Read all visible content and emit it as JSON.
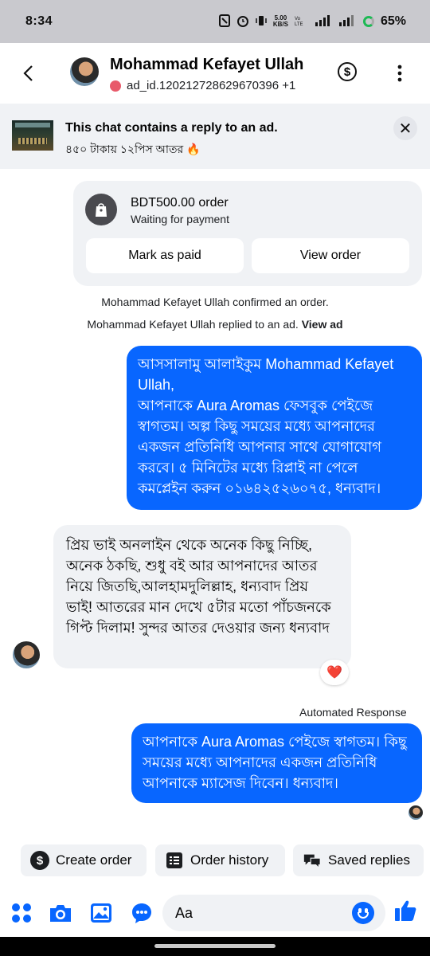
{
  "status_bar": {
    "time": "8:34",
    "net_speed_top": "5.00",
    "net_speed_bottom": "KB/S",
    "battery": "65%"
  },
  "header": {
    "contact_name": "Mohammad Kefayet Ullah",
    "ad_id": "ad_id.120212728629670396 +1",
    "payment_icon": "dollar-circle-icon",
    "more_icon": "vertical-dots-icon"
  },
  "ad_banner": {
    "title": "This chat contains a reply to an ad.",
    "subtitle": "৪৫০ টাকায় ১২পিস আতর 🔥"
  },
  "order": {
    "amount": "BDT500.00 order",
    "status": "Waiting for payment",
    "mark_paid_label": "Mark as paid",
    "view_order_label": "View order"
  },
  "system": {
    "confirmed": "Mohammad Kefayet Ullah confirmed an order.",
    "replied": "Mohammad Kefayet Ullah replied to an ad.",
    "view_ad": "View ad"
  },
  "messages": {
    "outgoing_1": "আসসালামু আলাইকুম Mohammad Kefayet Ullah,\nআপনাকে Aura Aromas ফেসবুক পেইজে স্বাগতম। অল্প কিছু সময়ের মধ্যে আপনাদের একজন প্রতিনিধি আপনার সাথে যোগাযোগ করবে। ৫ মিনিটের মধ্যে রিপ্লাই না পেলে কমপ্লেইন করুন ০১৬৪২৫২৬০৭৫, ধন্যবাদ।",
    "incoming_1": "প্রিয় ভাই অনলাইন থেকে অনেক কিছু নিচ্ছি, অনেক ঠকছি, শুধু বই আর আপনাদের আতর নিয়ে জিতছি,আলহামদুলিল্লাহ, ধন্যবাদ প্রিয় ভাই! আতরের মান দেখে ৫টার মতো পাঁচজনকে গিপ্ট দিলাম! সুন্দর আতর দেওয়ার জন্য ধন্যবাদ",
    "reaction": "❤️",
    "automated_label": "Automated Response",
    "outgoing_2": "আপনাকে Aura Aromas পেইজে স্বাগতম। কিছু সময়ের মধ্যে আপনাদের একজন প্রতিনিধি আপনাকে ম্যাসেজ দিবেন। ধন্যবাদ।"
  },
  "quick_actions": {
    "create_order": "Create order",
    "order_history": "Order history",
    "saved_replies": "Saved replies"
  },
  "composer": {
    "placeholder": "Aa"
  },
  "colors": {
    "accent": "#0866ff",
    "bubble_in": "#f0f2f5",
    "status_bar": "#c9c9ce"
  }
}
